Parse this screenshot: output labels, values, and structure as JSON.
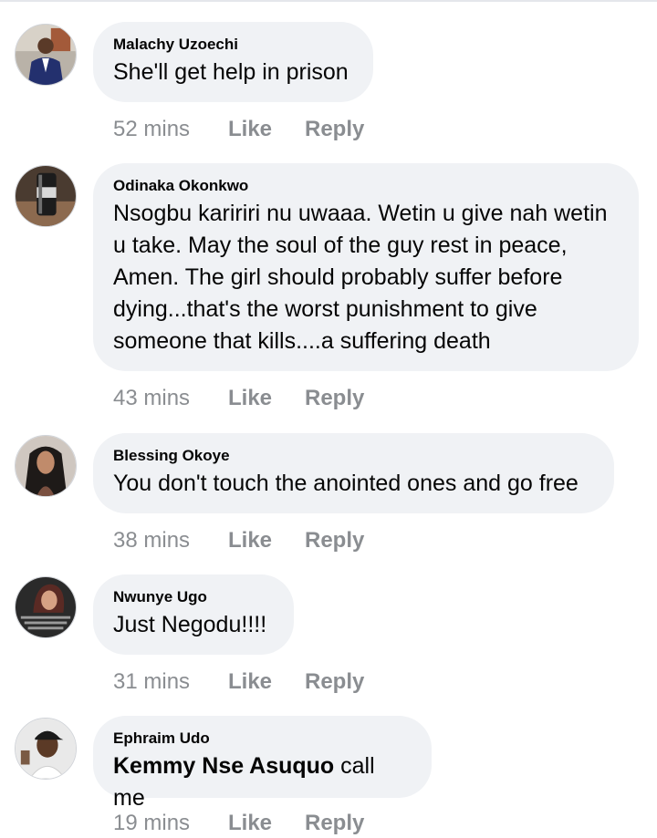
{
  "comments": [
    {
      "author": "Malachy Uzoechi",
      "text": "She'll get help in prison",
      "time": "52 mins",
      "like": "Like",
      "reply": "Reply",
      "avatar_icon": "person-in-suit-avatar"
    },
    {
      "author": "Odinaka Okonkwo",
      "text": "Nsogbu kaririri nu uwaaa. Wetin u give nah wetin u take. May the soul of the guy rest in peace, Amen. The girl should probably suffer before dying...that's the worst punishment to give someone that kills....a suffering death",
      "time": "43 mins",
      "like": "Like",
      "reply": "Reply",
      "avatar_icon": "can-avatar"
    },
    {
      "author": "Blessing Okoye",
      "text": "You don't touch the anointed ones and go free",
      "time": "38 mins",
      "like": "Like",
      "reply": "Reply",
      "avatar_icon": "woman-braids-avatar"
    },
    {
      "author": "Nwunye Ugo",
      "text": "Just Negodu!!!!",
      "time": "31 mins",
      "like": "Like",
      "reply": "Reply",
      "avatar_icon": "woman-quote-avatar"
    },
    {
      "author": "Ephraim Udo",
      "mention": "Kemmy Nse Asuquo",
      "text": " call me",
      "time": "19 mins",
      "like": "Like",
      "reply": "Reply",
      "avatar_icon": "man-cap-avatar"
    }
  ],
  "colors": {
    "bubble": "#f0f2f5",
    "meta": "#8a8d91",
    "text": "#050505"
  }
}
